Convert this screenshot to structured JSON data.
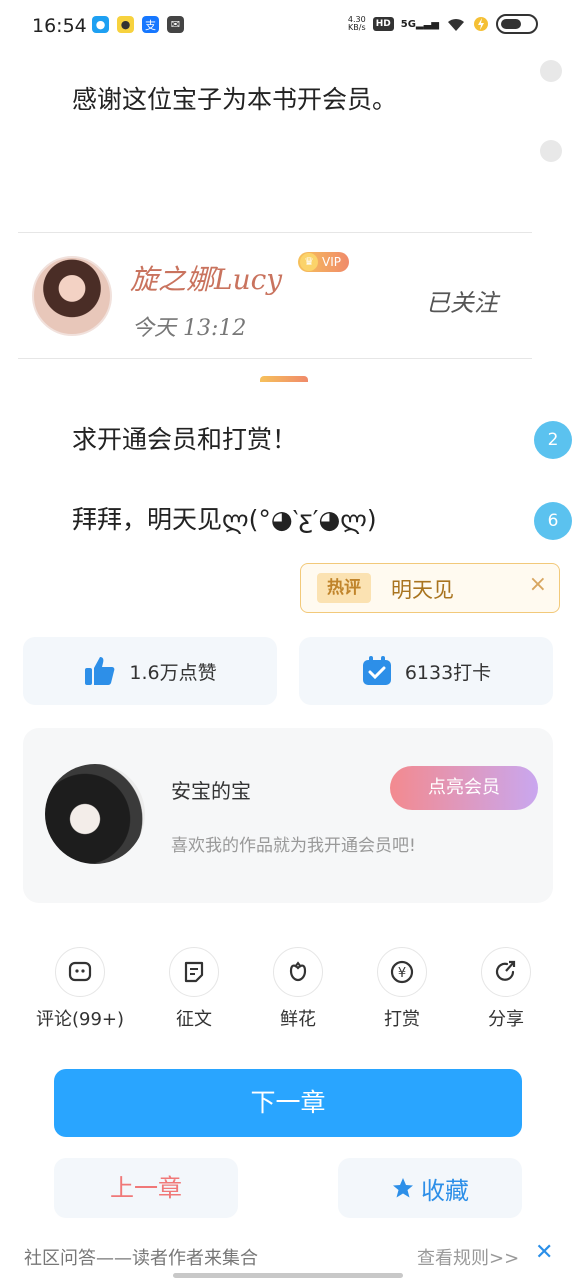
{
  "status_bar": {
    "time": "16:54",
    "net_speed_value": "4.30",
    "net_speed_unit": "KB/s",
    "hd": "HD",
    "signal": "5G"
  },
  "comments": [
    {
      "text": "感谢这位宝子为本书开会员。"
    }
  ],
  "commenter": {
    "name": "旋之娜Lucy",
    "vip": "VIP",
    "time": "今天 13:12",
    "follow_status": "已关注"
  },
  "reply_lines": [
    {
      "text": "求开通会员和打赏！",
      "count": "2"
    },
    {
      "text": "拜拜，明天见ლ(°◕‵ƹ′◕ლ)",
      "count": "6"
    }
  ],
  "hot_comment": {
    "tag": "热评",
    "text": "明天见",
    "close_symbol": "×"
  },
  "stats": {
    "likes": "1.6万点赞",
    "checkins": "6133打卡"
  },
  "author": {
    "name": "安宝的宝",
    "desc": "喜欢我的作品就为我开通会员吧!",
    "button": "点亮会员"
  },
  "actions": [
    {
      "label": "评论(99+)",
      "icon": "comment-icon"
    },
    {
      "label": "征文",
      "icon": "document-icon"
    },
    {
      "label": "鲜花",
      "icon": "flower-icon"
    },
    {
      "label": "打赏",
      "icon": "yen-icon"
    },
    {
      "label": "分享",
      "icon": "share-icon"
    }
  ],
  "nav": {
    "next": "下一章",
    "prev": "上一章",
    "favorite": "收藏"
  },
  "footer": {
    "title": "社区问答——读者作者来集合",
    "rules": "查看规则>>",
    "close": "✕"
  },
  "colors": {
    "primary": "#29a5ff",
    "hot_border": "#f2c97a",
    "bubble": "#5bc2ef"
  }
}
